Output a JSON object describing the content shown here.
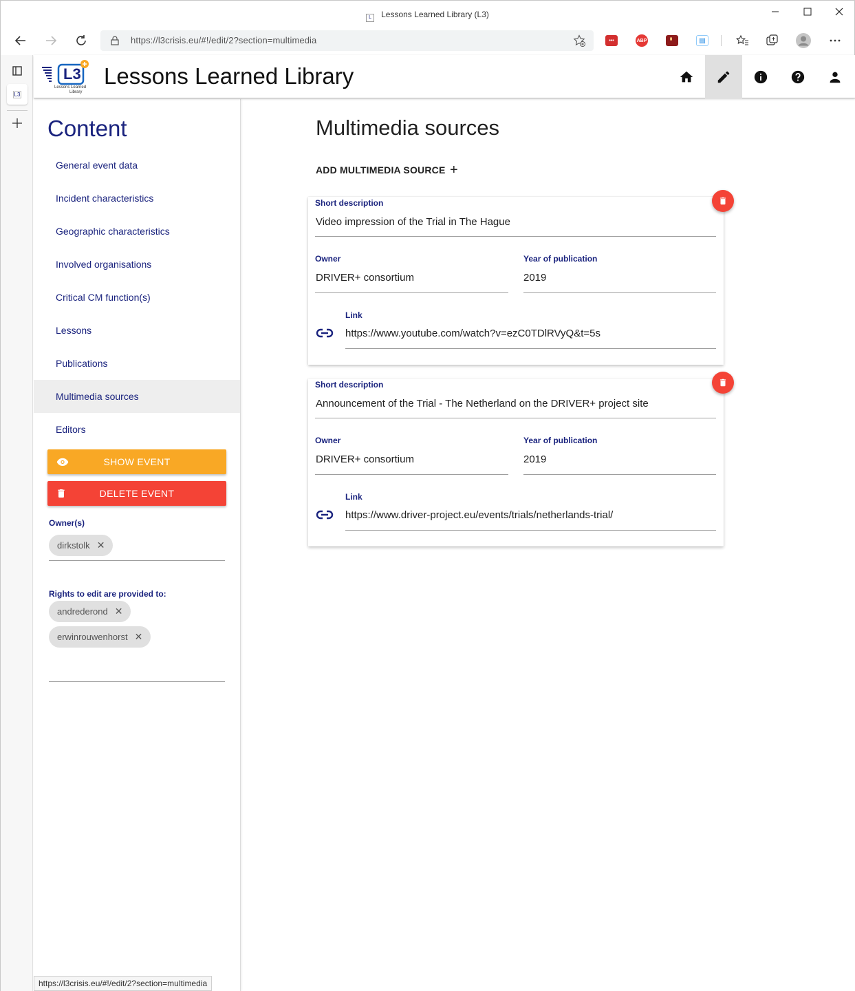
{
  "browser": {
    "window_title": "Lessons Learned Library (L3)",
    "url": "https://l3crisis.eu/#!/edit/2?section=multimedia",
    "status_url": "https://l3crisis.eu/#!/edit/2?section=multimedia",
    "extensions": [
      {
        "name": "lastpass-extension",
        "label": "•••",
        "color": "#d32f2f"
      },
      {
        "name": "adblock-plus-extension",
        "label": "ABP",
        "color": "#e53935"
      },
      {
        "name": "extension-3",
        "label": "",
        "color": "#b71c1c"
      },
      {
        "name": "reader-extension",
        "label": "",
        "color": "#1e88e5"
      }
    ]
  },
  "app": {
    "title": "Lessons Learned Library",
    "logo_text": "L3",
    "logo_caption_1": "Lessons Learned",
    "logo_caption_2": "Library",
    "header_icons": [
      "home-icon",
      "edit-icon",
      "info-icon",
      "help-icon",
      "account-icon"
    ]
  },
  "sidebar": {
    "heading": "Content",
    "items": [
      {
        "label": "General event data"
      },
      {
        "label": "Incident characteristics"
      },
      {
        "label": "Geographic characteristics"
      },
      {
        "label": "Involved organisations"
      },
      {
        "label": "Critical CM function(s)"
      },
      {
        "label": "Lessons"
      },
      {
        "label": "Publications"
      },
      {
        "label": "Multimedia sources",
        "active": true
      },
      {
        "label": "Editors"
      }
    ],
    "show_button": "SHOW EVENT",
    "delete_button": "DELETE EVENT",
    "owners_label": "Owner(s)",
    "owners": [
      "dirkstolk"
    ],
    "rights_label": "Rights to edit are provided to:",
    "editors": [
      "andrederond",
      "erwinrouwenhorst"
    ],
    "colors": {
      "show": "#f9a825",
      "delete": "#f44336",
      "accent": "#1a237e"
    }
  },
  "main": {
    "title": "Multimedia sources",
    "add_label": "ADD MULTIMEDIA SOURCE",
    "add_icon": "+",
    "field_labels": {
      "short_description": "Short description",
      "owner": "Owner",
      "year": "Year of publication",
      "link": "Link"
    },
    "sources": [
      {
        "short_description": "Video impression of the Trial in The Hague",
        "owner": "DRIVER+ consortium",
        "year": "2019",
        "link": "https://www.youtube.com/watch?v=ezC0TDlRVyQ&t=5s"
      },
      {
        "short_description": "Announcement of the Trial - The Netherland on the DRIVER+ project site",
        "owner": "DRIVER+ consortium",
        "year": "2019",
        "link": "https://www.driver-project.eu/events/trials/netherlands-trial/"
      }
    ]
  }
}
